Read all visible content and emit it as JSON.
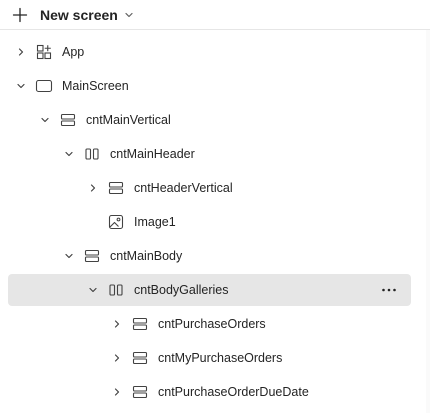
{
  "toolbar": {
    "new_screen_label": "New screen"
  },
  "tree": {
    "items": [
      {
        "label": "App",
        "icon": "app-icon",
        "expand": "collapsed"
      },
      {
        "label": "MainScreen",
        "icon": "screen-icon",
        "expand": "expanded"
      },
      {
        "label": "cntMainVertical",
        "icon": "vertical-container-icon",
        "expand": "expanded"
      },
      {
        "label": "cntMainHeader",
        "icon": "horizontal-container-icon",
        "expand": "expanded"
      },
      {
        "label": "cntHeaderVertical",
        "icon": "vertical-container-icon",
        "expand": "collapsed"
      },
      {
        "label": "Image1",
        "icon": "image-icon",
        "expand": "none"
      },
      {
        "label": "cntMainBody",
        "icon": "vertical-container-icon",
        "expand": "expanded"
      },
      {
        "label": "cntBodyGalleries",
        "icon": "horizontal-container-icon",
        "expand": "expanded",
        "selected": true
      },
      {
        "label": "cntPurchaseOrders",
        "icon": "vertical-container-icon",
        "expand": "collapsed"
      },
      {
        "label": "cntMyPurchaseOrders",
        "icon": "vertical-container-icon",
        "expand": "collapsed"
      },
      {
        "label": "cntPurchaseOrderDueDate",
        "icon": "vertical-container-icon",
        "expand": "collapsed"
      }
    ],
    "more_label": "···"
  },
  "colors": {
    "selected_row": "#e6e6e6",
    "text": "#242424",
    "divider": "#e6e6e6"
  }
}
